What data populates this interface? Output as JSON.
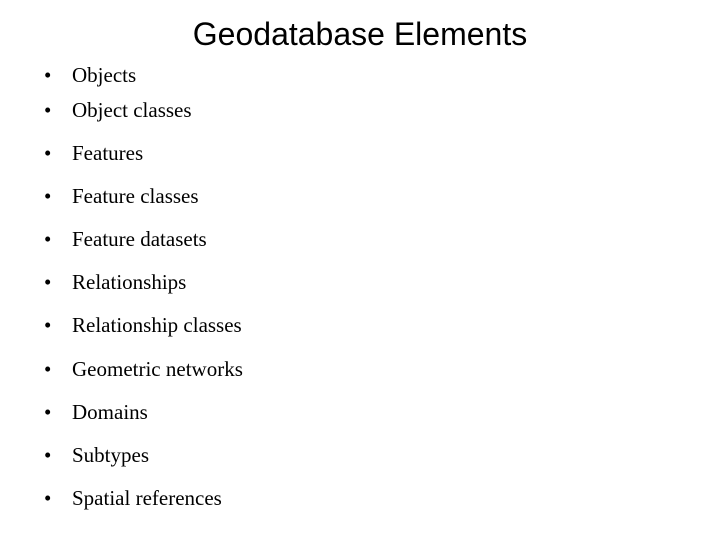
{
  "slide": {
    "title": "Geodatabase Elements",
    "bullet_glyph": "•",
    "items": [
      "Objects",
      "Object classes",
      "Features",
      "Feature classes",
      "Feature datasets",
      "Relationships",
      "Relationship classes",
      "Geometric networks",
      "Domains",
      "Subtypes",
      "Spatial references"
    ]
  }
}
